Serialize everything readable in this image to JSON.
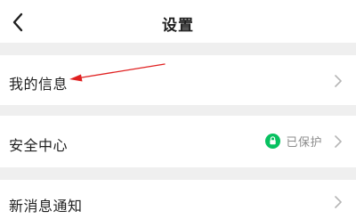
{
  "header": {
    "title": "设置",
    "back_icon": "chevron-left-icon"
  },
  "rows": [
    {
      "label": "我的信息",
      "chevron_icon": "chevron-right-icon"
    },
    {
      "label": "安全中心",
      "status_text": "已保护",
      "status_icon": "shield-check-icon",
      "status_color": "#07c160",
      "chevron_icon": "chevron-right-icon"
    },
    {
      "label": "新消息通知",
      "chevron_icon": "chevron-right-icon"
    }
  ],
  "annotation": {
    "type": "red-arrow-pointer",
    "color": "#e02020",
    "target": "我的信息"
  },
  "colors": {
    "background": "#ffffff",
    "section_gap": "#efefef",
    "text": "#1f1f1f",
    "muted": "#8c8c8c",
    "chevron": "#b5b5b5"
  }
}
